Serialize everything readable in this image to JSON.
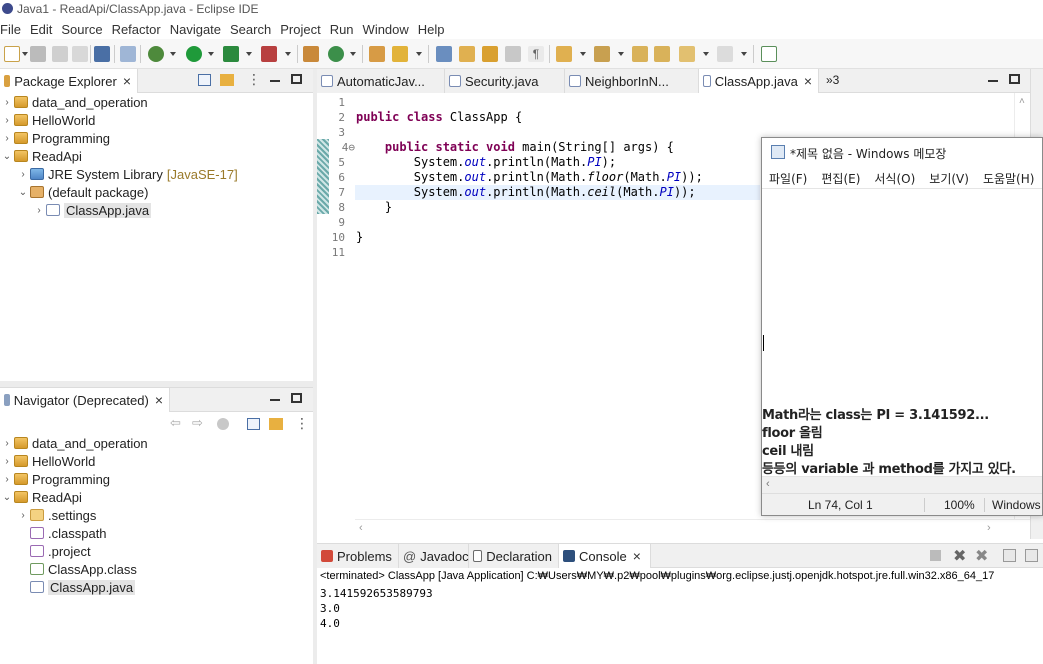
{
  "window": {
    "title": "Java1 - ReadApi/ClassApp.java - Eclipse IDE"
  },
  "menu": [
    "File",
    "Edit",
    "Source",
    "Refactor",
    "Navigate",
    "Search",
    "Project",
    "Run",
    "Window",
    "Help"
  ],
  "package_explorer": {
    "tab_label": "Package Explorer",
    "items": [
      {
        "label": "data_and_operation",
        "icon": "project-icon",
        "arrow": "›"
      },
      {
        "label": "HelloWorld",
        "icon": "project-icon",
        "arrow": "›"
      },
      {
        "label": "Programming",
        "icon": "project-icon",
        "arrow": "›"
      },
      {
        "label": "ReadApi",
        "icon": "project-icon",
        "arrow": "⌄"
      },
      {
        "label": "JRE System Library",
        "suffix": "[JavaSE-17]",
        "icon": "library-icon",
        "arrow": "›"
      },
      {
        "label": "(default package)",
        "icon": "package-icon",
        "arrow": "⌄"
      },
      {
        "label": "ClassApp.java",
        "icon": "java-file-icon",
        "arrow": "›"
      }
    ]
  },
  "navigator": {
    "tab_label": "Navigator (Deprecated)",
    "items": [
      {
        "label": "data_and_operation",
        "arrow": "›"
      },
      {
        "label": "HelloWorld",
        "arrow": "›"
      },
      {
        "label": "Programming",
        "arrow": "›"
      },
      {
        "label": "ReadApi",
        "arrow": "⌄"
      },
      {
        "label": ".settings",
        "arrow": "›"
      },
      {
        "label": ".classpath",
        "arrow": ""
      },
      {
        "label": ".project",
        "arrow": ""
      },
      {
        "label": "ClassApp.class",
        "arrow": ""
      },
      {
        "label": "ClassApp.java",
        "arrow": ""
      }
    ]
  },
  "editor": {
    "tabs": [
      "AutomaticJav...",
      "Security.java",
      "NeighborInN...",
      "ClassApp.java"
    ],
    "overflow": "»3",
    "line_numbers": [
      "1",
      "2",
      "3",
      "4⊖",
      "5",
      "6",
      "7",
      "8",
      "9",
      "10",
      "11"
    ],
    "code": {
      "l2a": "public class ",
      "l2b": "ClassApp {",
      "l4a": "    public static void ",
      "l4b": "main(String[] args) {",
      "l5a": "        System.",
      "l5b": "out",
      "l5c": ".println(Math.",
      "l5d": "PI",
      "l5e": ");",
      "l6a": "        System.",
      "l6b": "out",
      "l6c": ".println(Math.",
      "l6d": "floor",
      "l6e": "(Math.",
      "l6f": "PI",
      "l6g": "));",
      "l7a": "        System.",
      "l7b": "out",
      "l7c": ".println(Math.",
      "l7d": "ceil",
      "l7e": "(Math.",
      "l7f": "PI",
      "l7g": "));",
      "l8": "    }",
      "l10": "}"
    }
  },
  "notepad": {
    "title": "*제목 없음 - Windows 메모장",
    "menu": [
      "파일(F)",
      "편집(E)",
      "서식(O)",
      "보기(V)",
      "도움말(H)"
    ],
    "lines": [
      "Math라는 class는 PI = 3.141592...",
      "floor 올림",
      "ceil 내림",
      "등등의 variable 과 method를 가지고 있다."
    ],
    "status": {
      "position": "Ln 74, Col 1",
      "zoom": "100%",
      "encoding": "Windows"
    }
  },
  "console": {
    "tabs": [
      "Problems",
      "Javadoc",
      "Declaration",
      "Console"
    ],
    "terminated": "<terminated> ClassApp [Java Application] C:₩Users₩MY₩.p2₩pool₩plugins₩org.eclipse.justj.openjdk.hotspot.jre.full.win32.x86_64_17",
    "output": [
      "3.141592653589793",
      "3.0",
      "4.0"
    ]
  }
}
